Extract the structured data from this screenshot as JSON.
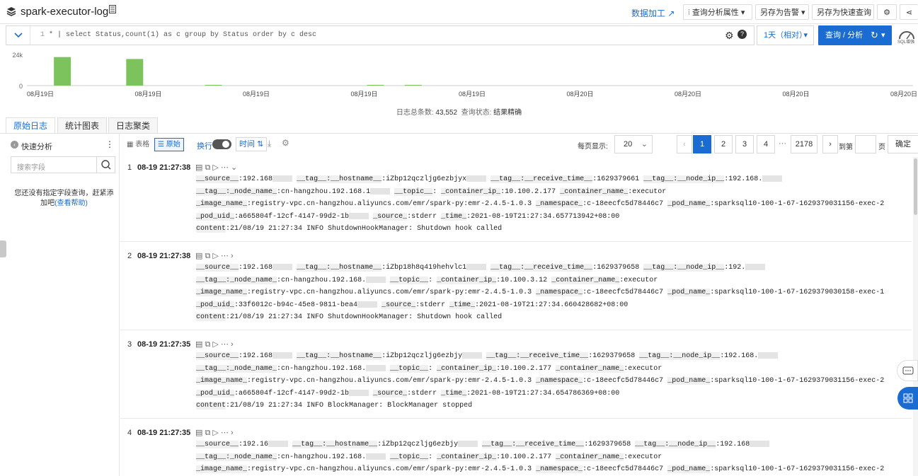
{
  "header": {
    "title": "spark-executor-log",
    "data_process": "数据加工",
    "query_attr": "查询分析属性",
    "save_alert": "另存为告警",
    "save_quick": "另存为快速查询"
  },
  "query": {
    "line_no": "1",
    "text": "* | select Status,count(1) as c group by Status order by c desc",
    "time_range": "1天（相对）",
    "submit": "查询 / 分析",
    "sql_icon_label": "SQL增强"
  },
  "chart_data": {
    "type": "bar",
    "categories": [
      "08月19日",
      "08月19日",
      "08月19日",
      "08月19日",
      "08月19日",
      "08月20日",
      "08月20日",
      "08月20日",
      "08月20日"
    ],
    "ylabel": "",
    "ylim": [
      0,
      24000
    ],
    "y_ticks": [
      "24k",
      "0"
    ],
    "bars": [
      {
        "slot": 0.25,
        "value": 22000
      },
      {
        "slot": 0.92,
        "value": 20500
      },
      {
        "slot": 1.65,
        "value": 300
      },
      {
        "slot": 3.15,
        "value": 200
      },
      {
        "slot": 3.5,
        "value": 200
      }
    ],
    "bar_color": "#7cc35e"
  },
  "stats": {
    "total_label": "日志总条数:",
    "total_value": "43,552",
    "status_label": "查询状态:",
    "status_value": "结果精确"
  },
  "tabs": [
    "原始日志",
    "统计图表",
    "日志聚类"
  ],
  "sidebar": {
    "quick_analysis": "快速分析",
    "search_placeholder": "搜索字段",
    "empty_text": "您还没有指定字段查询，赶紧添加吧",
    "help_link": "(查看帮助)"
  },
  "toolbar": {
    "table": "表格",
    "raw": "原始",
    "wrap": "换行",
    "time": "时间",
    "per_page_label": "每页显示:",
    "per_page": "20",
    "pages": [
      "1",
      "2",
      "3",
      "4"
    ],
    "ellipsis": "···",
    "last_page": "2178",
    "goto_label": "到第",
    "page_unit": "页",
    "confirm": "确定"
  },
  "logs": [
    {
      "idx": "1",
      "time": "08-19 21:27:38",
      "source": "192.168",
      "hostname": "iZbp12qczljg6ezbjyx",
      "receive_time": "1629379661",
      "node_ip": "192.168.",
      "node_name": "cn-hangzhou.192.168.1",
      "container_ip": "10.100.2.177",
      "container_name": "executor",
      "image_name": "registry-vpc.cn-hangzhou.aliyuncs.com/emr/spark-py:emr-2.4.5-1.0.3",
      "namespace": "c-18eecfc5d78446c7",
      "pod_name": "sparksql10-100-1-67-1629379031156-exec-2",
      "pod_uid": "a665804f-12cf-4147-99d2-1b",
      "stream": "stderr",
      "time_full": "2021-08-19T21:27:34.657713942+08:00",
      "content": "21/08/19 21:27:34 INFO ShutdownHookManager: Shutdown hook called"
    },
    {
      "idx": "2",
      "time": "08-19 21:27:38",
      "source": "192.168",
      "hostname": "iZbp18h8q419hehvlc1",
      "receive_time": "1629379658",
      "node_ip": "192.",
      "node_name": "cn-hangzhou.192.168.",
      "container_ip": "10.100.3.12",
      "container_name": "executor",
      "image_name": "registry-vpc.cn-hangzhou.aliyuncs.com/emr/spark-py:emr-2.4.5-1.0.3",
      "namespace": "c-18eecfc5d78446c7",
      "pod_name": "sparksql10-100-1-67-1629379030158-exec-1",
      "pod_uid": "33f6012c-b94c-45e8-9811-bea4",
      "stream": "stderr",
      "time_full": "2021-08-19T21:27:34.660428682+08:00",
      "content": "21/08/19 21:27:34 INFO ShutdownHookManager: Shutdown hook called"
    },
    {
      "idx": "3",
      "time": "08-19 21:27:35",
      "source": "192.168",
      "hostname": "iZbp12qczljg6ezbjy",
      "receive_time": "1629379658",
      "node_ip": "192.168.",
      "node_name": "cn-hangzhou.192.168.",
      "container_ip": "10.100.2.177",
      "container_name": "executor",
      "image_name": "registry-vpc.cn-hangzhou.aliyuncs.com/emr/spark-py:emr-2.4.5-1.0.3",
      "namespace": "c-18eecfc5d78446c7",
      "pod_name": "sparksql10-100-1-67-1629379031156-exec-2",
      "pod_uid": "a665804f-12cf-4147-99d2-1b",
      "stream": "stderr",
      "time_full": "2021-08-19T21:27:34.654786369+08:00",
      "content": "21/08/19 21:27:34 INFO BlockManager: BlockManager stopped"
    },
    {
      "idx": "4",
      "time": "08-19 21:27:35",
      "source": "192.16",
      "hostname": "iZbp12qczljg6ezbjy",
      "receive_time": "1629379658",
      "node_ip": "192.168",
      "node_name": "cn-hangzhou.192.168.",
      "container_ip": "10.100.2.177",
      "container_name": "executor",
      "image_name": "registry-vpc.cn-hangzhou.aliyuncs.com/emr/spark-py:emr-2.4.5-1.0.3",
      "namespace": "c-18eecfc5d78446c7",
      "pod_name": "sparksql10-100-1-67-1629379031156-exec-2",
      "pod_uid": "",
      "stream": "",
      "time_full": "",
      "content": ""
    }
  ]
}
